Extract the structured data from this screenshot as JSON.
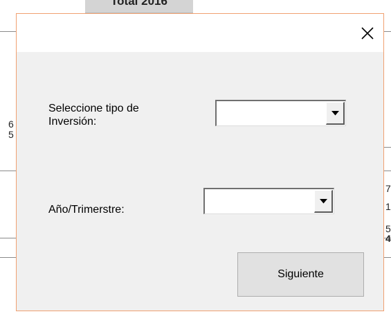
{
  "background_sheet": {
    "header_label": "Total 2016",
    "left_fragments": [
      "6",
      "5"
    ],
    "right_fragments": [
      "7",
      "1",
      "5",
      "4"
    ]
  },
  "dialog": {
    "close_icon": "close-icon",
    "tipo_inversion": {
      "label": "Seleccione tipo de\nInversión:",
      "selected_value": ""
    },
    "anio_trimestre": {
      "label": "Año/Trimerstre:",
      "selected_value": ""
    },
    "next_button_label": "Siguiente"
  }
}
